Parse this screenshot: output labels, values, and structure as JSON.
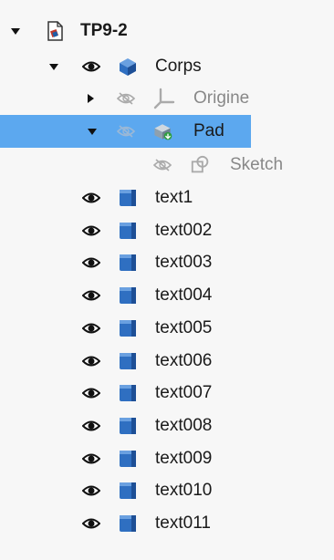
{
  "tree": {
    "root": {
      "label": "TP9-2"
    },
    "body": {
      "label": "Corps"
    },
    "origin": {
      "label": "Origine"
    },
    "pad": {
      "label": "Pad"
    },
    "sketch": {
      "label": "Sketch"
    },
    "texts": [
      {
        "label": "text1"
      },
      {
        "label": "text002"
      },
      {
        "label": "text003"
      },
      {
        "label": "text004"
      },
      {
        "label": "text005"
      },
      {
        "label": "text006"
      },
      {
        "label": "text007"
      },
      {
        "label": "text008"
      },
      {
        "label": "text009"
      },
      {
        "label": "text010"
      },
      {
        "label": "text011"
      }
    ]
  },
  "icons": {
    "expand": "triangle-down-icon",
    "collapse": "triangle-right-icon",
    "visible": "eye-icon",
    "hidden": "eye-slash-icon",
    "document": "document-icon",
    "body": "body-icon",
    "origin": "axis-icon",
    "pad": "pad-icon",
    "sketch": "sketch-icon",
    "feature": "cube-icon"
  },
  "colors": {
    "selection": "#5ca8ef",
    "cube": "#2f6fc1",
    "muted_text": "#888888"
  }
}
